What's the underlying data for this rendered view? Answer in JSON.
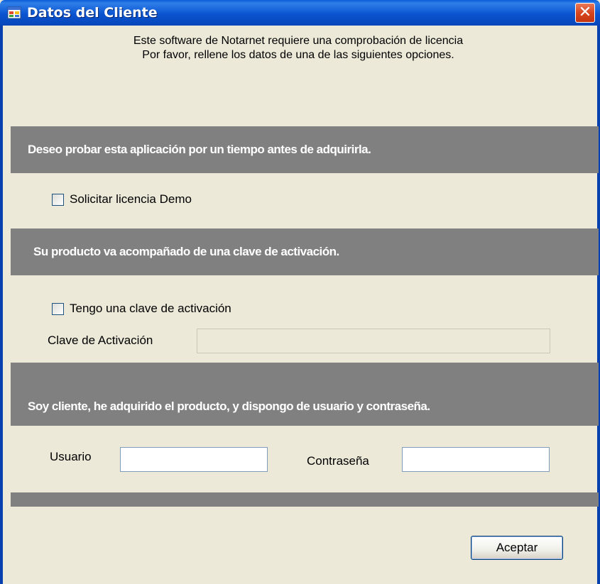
{
  "window": {
    "title": "Datos del Cliente",
    "close_symbol": "✕",
    "icon": "app-window-icon"
  },
  "intro": {
    "line1": "Este software de Notarnet requiere una comprobación de licencia",
    "line2": "Por favor, rellene los datos de una de las siguientes opciones."
  },
  "demo_section": {
    "header": "Deseo probar esta aplicación por un tiempo antes de adquirirla.",
    "checkbox_label": "Solicitar licencia Demo",
    "checked": false
  },
  "activation_section": {
    "header": "Su producto va acompañado de una clave de activación.",
    "checkbox_label": "Tengo una clave de activación",
    "checked": false,
    "key_label": "Clave de Activación",
    "key_value": ""
  },
  "customer_section": {
    "header": "Soy cliente, he adquirido el producto, y dispongo de usuario y contraseña.",
    "user_label": "Usuario",
    "user_value": "",
    "password_label": "Contraseña",
    "password_value": ""
  },
  "footer": {
    "accept_label": "Aceptar"
  },
  "colors": {
    "titlebar": "#0a54d1",
    "section_bar": "#808080",
    "dialog_background": "#ece9d8",
    "close_button": "#d8461e"
  }
}
